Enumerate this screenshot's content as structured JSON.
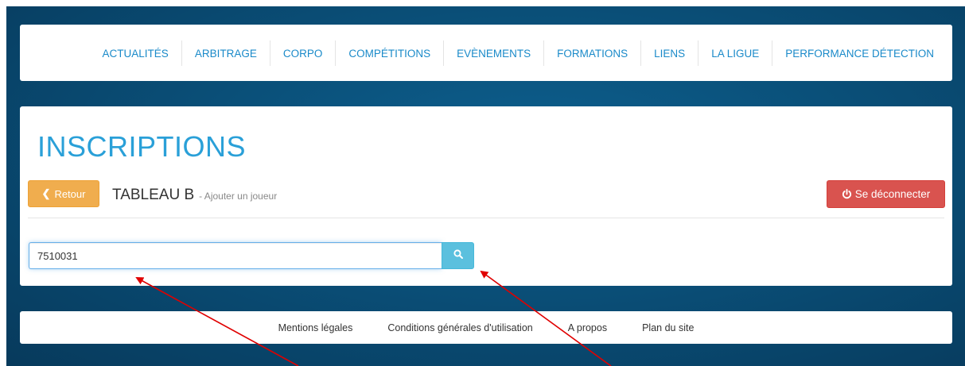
{
  "nav": {
    "items": [
      {
        "label": "ACTUALITÉS"
      },
      {
        "label": "ARBITRAGE"
      },
      {
        "label": "CORPO"
      },
      {
        "label": "COMPÉTITIONS"
      },
      {
        "label": "EVÈNEMENTS"
      },
      {
        "label": "FORMATIONS"
      },
      {
        "label": "LIENS"
      },
      {
        "label": "LA LIGUE"
      },
      {
        "label": "PERFORMANCE DÉTECTION"
      }
    ]
  },
  "page": {
    "title": "INSCRIPTIONS",
    "back_label": "Retour",
    "table_title": "TABLEAU B",
    "table_subtitle": "- Ajouter un joueur",
    "logout_label": "Se déconnecter"
  },
  "search": {
    "value": "7510031",
    "button_icon": "search-icon"
  },
  "footer": {
    "links": [
      {
        "label": "Mentions légales"
      },
      {
        "label": "Conditions générales d'utilisation"
      },
      {
        "label": "A propos"
      },
      {
        "label": "Plan du site"
      }
    ]
  },
  "colors": {
    "accent": "#2aa0d8",
    "link": "#1a8ac9",
    "back_button": "#f0ad4e",
    "logout_button": "#d9534f",
    "search_button": "#5bc0de",
    "background": "#0a4f78",
    "annotation_arrow": "#e00000"
  }
}
